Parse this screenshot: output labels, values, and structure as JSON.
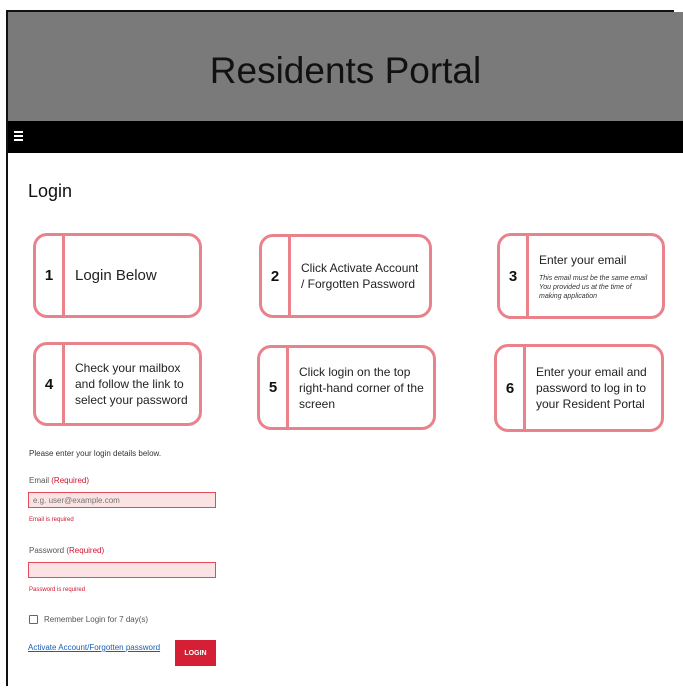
{
  "header": {
    "title": "Residents Portal"
  },
  "nav": {
    "menu_icon": "hamburger-menu-icon"
  },
  "page": {
    "title": "Login"
  },
  "steps": [
    {
      "number": "1",
      "text": "Login Below",
      "note": ""
    },
    {
      "number": "2",
      "text": "Click Activate Account / Forgotten Password",
      "note": ""
    },
    {
      "number": "3",
      "text": "Enter your email",
      "note": "This email must be the same email You provided us at the time of making application"
    },
    {
      "number": "4",
      "text": "Check your mailbox and follow the link to select your password",
      "note": ""
    },
    {
      "number": "5",
      "text": "Click login on the top right-hand corner of the screen",
      "note": ""
    },
    {
      "number": "6",
      "text": "Enter your email and password to log in to your Resident Portal",
      "note": ""
    }
  ],
  "form": {
    "intro": "Please enter your login details below.",
    "email": {
      "label": "Email",
      "required": "(Required)",
      "placeholder": "e.g. user@example.com",
      "value": "",
      "error": "Email is required"
    },
    "password": {
      "label": "Password",
      "required": "(Required)",
      "value": "",
      "error": "Password is required"
    },
    "remember": {
      "label": "Remember Login for 7 day(s)",
      "checked": false
    },
    "activate_link": "Activate Account/Forgotten password",
    "login_button": "LOGIN"
  },
  "colors": {
    "header_bg": "#7a7a7a",
    "nav_bg": "#000000",
    "step_border": "#e9828a",
    "error": "#d0142c",
    "button": "#d51f34",
    "link": "#1a5fb4"
  }
}
